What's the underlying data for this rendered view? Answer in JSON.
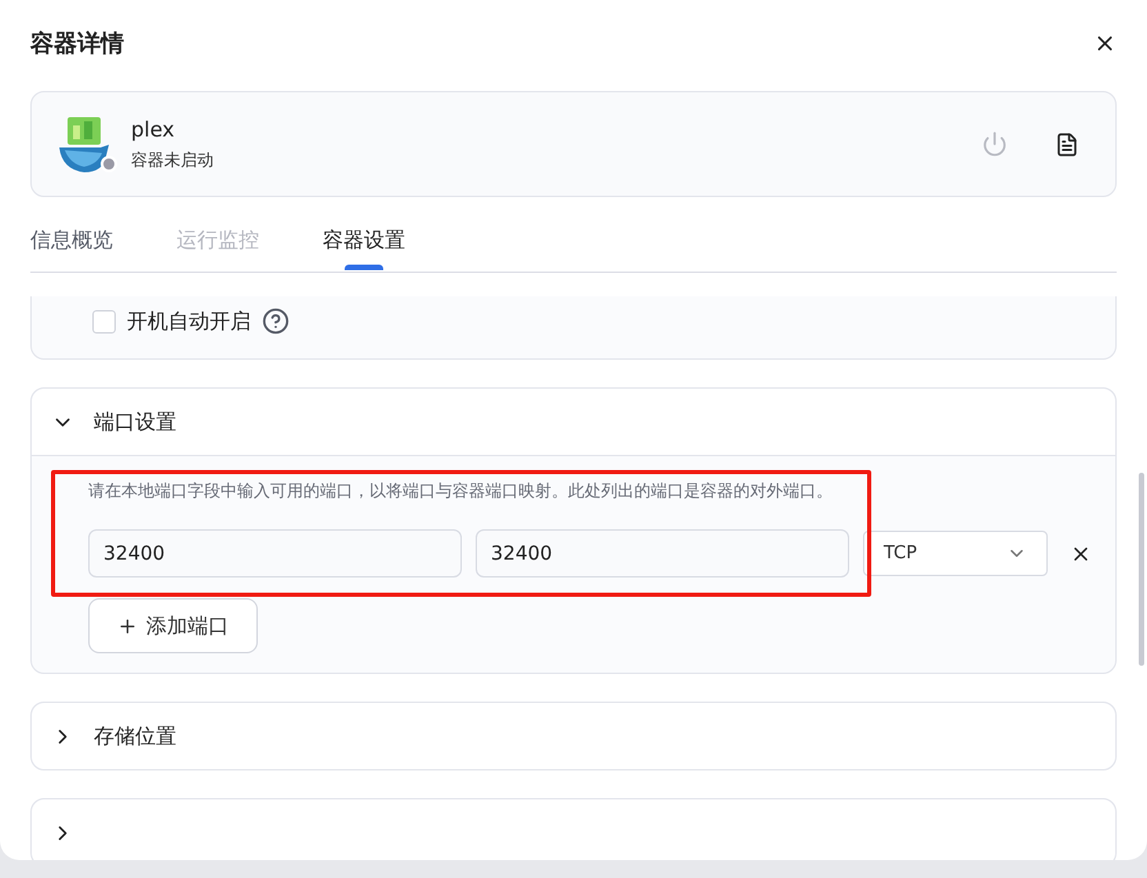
{
  "dialog": {
    "title": "容器详情"
  },
  "container": {
    "name": "plex",
    "status": "容器未启动",
    "running": false
  },
  "tabs": [
    {
      "label": "信息概览",
      "selected": false,
      "disabled": false
    },
    {
      "label": "运行监控",
      "selected": false,
      "disabled": true
    },
    {
      "label": "容器设置",
      "selected": true,
      "disabled": false
    }
  ],
  "sections": [
    {
      "kind": "options",
      "options": [
        {
          "label": "开机自动开启",
          "checked": false
        }
      ]
    },
    {
      "kind": "ports",
      "title": "端口设置",
      "expanded": true,
      "description": "请在本地端口字段中输入可用的端口，以将端口与容器端口映射。此处列出的端口是容器的对外端口。",
      "ports": [
        {
          "local": "32400",
          "container": "32400",
          "protocol": "TCP"
        }
      ],
      "add_button": "添加端口"
    },
    {
      "kind": "collapsible",
      "title": "存储位置",
      "expanded": false
    },
    {
      "kind": "collapsible",
      "expanded": false
    }
  ]
}
